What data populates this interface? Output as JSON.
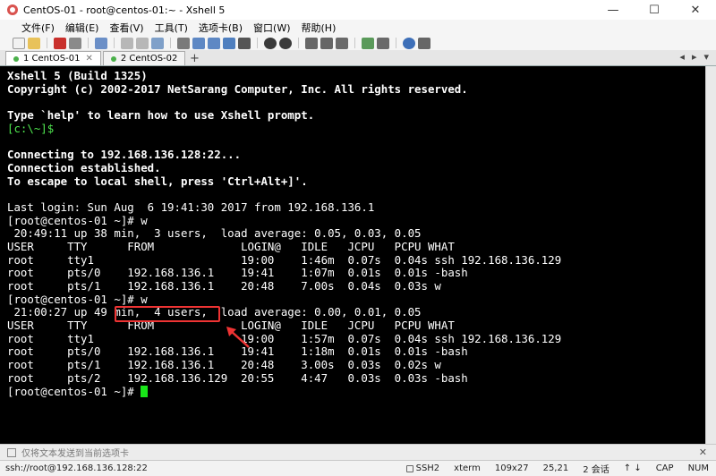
{
  "window": {
    "title": "CentOS-01 - root@centos-01:~ - Xshell 5",
    "minimize": "—",
    "maximize": "☐",
    "close": "✕"
  },
  "menu": [
    "文件(F)",
    "编辑(E)",
    "查看(V)",
    "工具(T)",
    "选项卡(B)",
    "窗口(W)",
    "帮助(H)"
  ],
  "tabs": [
    {
      "label": "1 CentOS-01",
      "active": true
    },
    {
      "label": "2 CentOS-02",
      "active": false
    }
  ],
  "tab_add": "+",
  "terminal": {
    "lines": [
      {
        "text": "Xshell 5 (Build 1325)",
        "style": "bold"
      },
      {
        "text": "Copyright (c) 2002-2017 NetSarang Computer, Inc. All rights reserved.",
        "style": "bold"
      },
      {
        "text": "",
        "style": ""
      },
      {
        "text": "Type `help' to learn how to use Xshell prompt.",
        "style": "bold"
      },
      {
        "text": "[c:\\~]$",
        "style": "green"
      },
      {
        "text": "",
        "style": ""
      },
      {
        "text": "Connecting to 192.168.136.128:22...",
        "style": "bold"
      },
      {
        "text": "Connection established.",
        "style": "bold"
      },
      {
        "text": "To escape to local shell, press 'Ctrl+Alt+]'.",
        "style": "bold"
      },
      {
        "text": "",
        "style": ""
      },
      {
        "text": "Last login: Sun Aug  6 19:41:30 2017 from 192.168.136.1",
        "style": ""
      },
      {
        "text": "[root@centos-01 ~]# w",
        "style": ""
      },
      {
        "text": " 20:49:11 up 38 min,  3 users,  load average: 0.05, 0.03, 0.05",
        "style": ""
      },
      {
        "text": "USER     TTY      FROM             LOGIN@   IDLE   JCPU   PCPU WHAT",
        "style": ""
      },
      {
        "text": "root     tty1                      19:00    1:46m  0.07s  0.04s ssh 192.168.136.129",
        "style": ""
      },
      {
        "text": "root     pts/0    192.168.136.1    19:41    1:07m  0.01s  0.01s -bash",
        "style": ""
      },
      {
        "text": "root     pts/1    192.168.136.1    20:48    7.00s  0.04s  0.03s w",
        "style": ""
      },
      {
        "text": "[root@centos-01 ~]# w",
        "style": ""
      },
      {
        "text": " 21:00:27 up 49 min,  4 users,  load average: 0.00, 0.01, 0.05",
        "style": ""
      },
      {
        "text": "USER     TTY      FROM             LOGIN@   IDLE   JCPU   PCPU WHAT",
        "style": ""
      },
      {
        "text": "root     tty1                      19:00    1:57m  0.07s  0.04s ssh 192.168.136.129",
        "style": ""
      },
      {
        "text": "root     pts/0    192.168.136.1    19:41    1:18m  0.01s  0.01s -bash",
        "style": ""
      },
      {
        "text": "root     pts/1    192.168.136.1    20:48    3.00s  0.03s  0.02s w",
        "style": ""
      },
      {
        "text": "root     pts/2    192.168.136.129  20:55    4:47   0.03s  0.03s -bash",
        "style": ""
      }
    ],
    "prompt": "[root@centos-01 ~]# "
  },
  "compose_placeholder": "仅将文本发送到当前选项卡",
  "status": {
    "connection": "ssh://root@192.168.136.128:22",
    "protocol": "SSH2",
    "term": "xterm",
    "size": "109x27",
    "cursor": "25,21",
    "sessions": "2 会话",
    "caps": "CAP",
    "num": "NUM"
  },
  "colors": {
    "terminal_bg": "#000000",
    "terminal_fg": "#ffffff",
    "prompt_green": "#4fe64f",
    "cursor_green": "#19e619",
    "highlight_red": "#e33333"
  }
}
